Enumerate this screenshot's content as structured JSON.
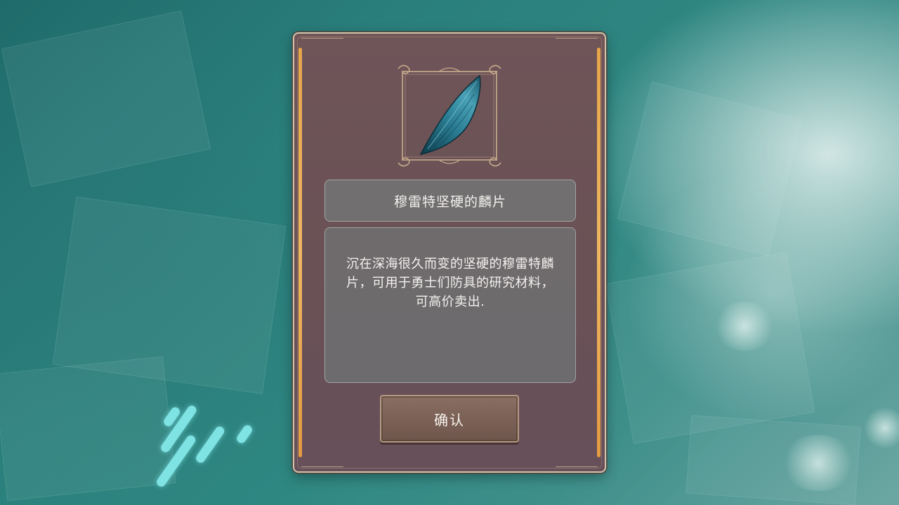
{
  "background": {
    "description_colors": {
      "water_deep": "#1f6b6b",
      "water_light": "#6da7a3",
      "streak": "#7fe3e3"
    }
  },
  "dialog": {
    "item": {
      "icon": "blue-scale-icon",
      "name": "穆雷特坚硬的麟片",
      "description_lines": [
        "沉在深海很久而变的坚硬的穆雷特麟",
        "片，可用于勇士们防具的研究材料，",
        "可高价卖出."
      ]
    },
    "confirm_label": "确认",
    "colors": {
      "panel": "#6a5155",
      "frame": "#d6c2a8",
      "side_bar": "#f0b860",
      "button": "#7b6156"
    }
  }
}
